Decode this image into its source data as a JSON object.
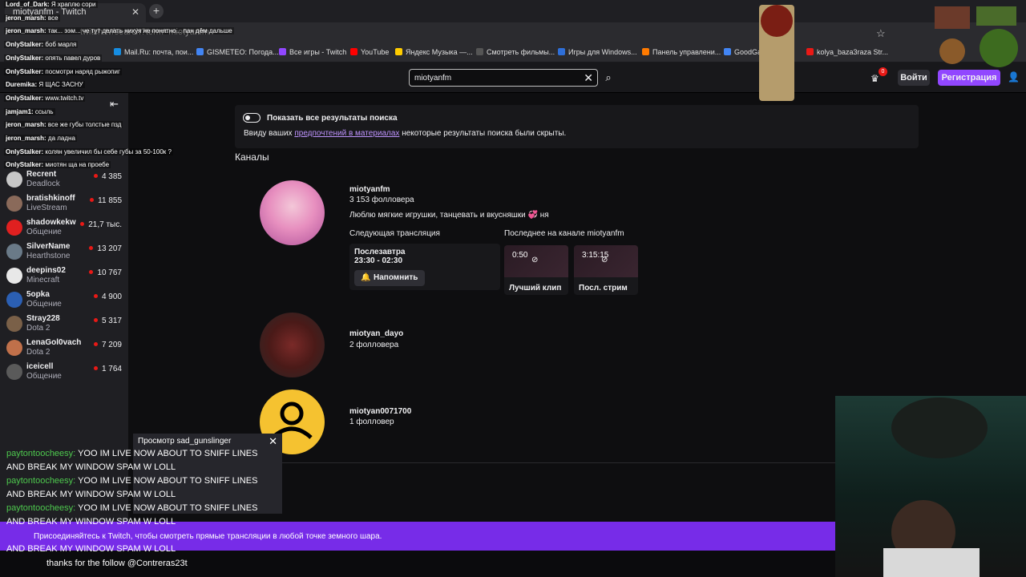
{
  "browser": {
    "tab_title": "miotyanfm - Twitch",
    "url": "twitch.tv/search?term=miotyanfm",
    "bookmarks": [
      {
        "label": "Mail.Ru: почта, пои...",
        "color": "#168de2"
      },
      {
        "label": "GISMETEO: Погода...",
        "color": "#4285f4"
      },
      {
        "label": "Все игры - Twitch",
        "color": "#9147ff"
      },
      {
        "label": "YouTube",
        "color": "#ff0000"
      },
      {
        "label": "Яндекс Музыка —...",
        "color": "#ffcc00"
      },
      {
        "label": "Смотреть фильмы...",
        "color": "#555555"
      },
      {
        "label": "Игры для Windows...",
        "color": "#2f6fd8"
      },
      {
        "label": "Панель управлени...",
        "color": "#ff7a00"
      },
      {
        "label": "GoodGam...",
        "color": "#4285f4"
      },
      {
        "label": "kolya_baza3raza Str...",
        "color": "#e91916"
      }
    ]
  },
  "topbar": {
    "search_value": "miotyanfm",
    "notif_count": "0",
    "login_label": "Войти",
    "signup_label": "Регистрация"
  },
  "sidebar": {
    "channels": [
      {
        "name": "Recrent",
        "game": "Deadlock",
        "viewers": "4 385",
        "color": "#c7c7c7"
      },
      {
        "name": "bratishkinoff",
        "game": "LiveStream",
        "viewers": "11 855",
        "color": "#8a6a5a"
      },
      {
        "name": "shadowkekw",
        "game": "Общение",
        "viewers": "21,7 тыс.",
        "color": "#e02020"
      },
      {
        "name": "SilverName",
        "game": "Hearthstone",
        "viewers": "13 207",
        "color": "#6a7a88"
      },
      {
        "name": "deepins02",
        "game": "Minecraft",
        "viewers": "10 767",
        "color": "#e8e8e8"
      },
      {
        "name": "5opka",
        "game": "Общение",
        "viewers": "4 900",
        "color": "#2b5fb3"
      },
      {
        "name": "Stray228",
        "game": "Dota 2",
        "viewers": "5 317",
        "color": "#7a6048"
      },
      {
        "name": "LenaGol0vach",
        "game": "Dota 2",
        "viewers": "7 209",
        "color": "#c0704a"
      },
      {
        "name": "iceicell",
        "game": "Общение",
        "viewers": "1 764",
        "color": "#5a5a5a"
      }
    ]
  },
  "chat": [
    {
      "user": "Lord_of_Dark:",
      "msg": " Я храплю сори"
    },
    {
      "user": "jeron_marsh:",
      "msg": " все"
    },
    {
      "user": "jeron_marsh:",
      "msg": " так... ээм... че тут делать нихуя не понятно... пан дём дальше"
    },
    {
      "user": "OnlyStalker:",
      "msg": " боб марля"
    },
    {
      "user": "OnlyStalker:",
      "msg": " опять павел дуров"
    },
    {
      "user": "OnlyStalker:",
      "msg": " посмотри наряд рыжопиг"
    },
    {
      "user": "Duremika:",
      "msg": " Я ЩАС ЗАСНУ"
    },
    {
      "user": "OnlyStalker:",
      "msg": " www.twitch.tv"
    },
    {
      "user": "jamjam1:",
      "msg": " ссыль"
    },
    {
      "user": "jeron_marsh:",
      "msg": " все же губы толстые пзд"
    },
    {
      "user": "jeron_marsh:",
      "msg": " да ладна"
    },
    {
      "user": "OnlyStalker:",
      "msg": " колян увеличил бы себе губы за 50-100к ?"
    },
    {
      "user": "OnlyStalker:",
      "msg": " миотян ща на проебе"
    }
  ],
  "results": {
    "toggle_label": "Показать все результаты поиска",
    "hidden_note_before": "Ввиду ваших ",
    "hidden_note_link": "предпочтений в материалах",
    "hidden_note_after": " некоторые результаты поиска были скрыты.",
    "section_title": "Каналы",
    "main": {
      "name": "miotyanfm",
      "followers": "3 153 фолловера",
      "bio": "Люблю мягкие игрушки, танцевать и вкусняшки",
      "bio_tail": " ня",
      "next_label": "Следующая трансляция",
      "next_day": "Послезавтра",
      "next_time": "23:30 - 02:30",
      "remind_label": "Напомнить",
      "latest_label": "Последнее на канале miotyanfm",
      "clip_duration": "0:50",
      "clip_label": "Лучший клип",
      "stream_duration": "3:15:15",
      "stream_label": "Посл. стрим"
    },
    "second": {
      "name": "miotyan_dayo",
      "followers": "2 фолловера"
    },
    "third": {
      "name": "miotyan0071700",
      "followers": "1 фолловер"
    }
  },
  "mini_player": {
    "title": "Просмотр sad_gunslinger"
  },
  "spam": {
    "user": "paytontoocheesy:",
    "line1": " YOO IM LIVE NOW ABOUT TO SNIFF LINES",
    "line2": "AND BREAK MY WINDOW SPAM W LOLL"
  },
  "banner": {
    "text": "Присоединяйтесь к Twitch, чтобы смотреть прямые трансляции в любой точке земного шара."
  },
  "taskbar_text": "thanks for the follow @Contreras23t"
}
